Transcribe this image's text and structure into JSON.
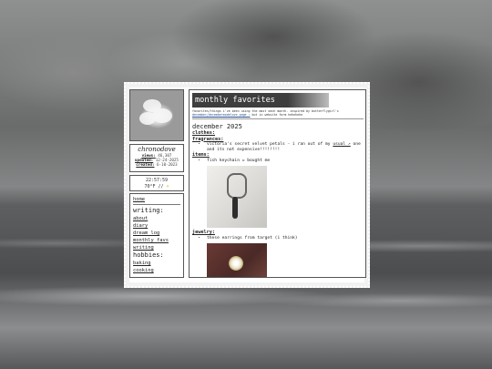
{
  "profile": {
    "name": "chronodove",
    "views_label": "views:",
    "views_value": "46,307",
    "updated_label": "updated:",
    "updated_value": "12-24-2025",
    "created_label": "created:",
    "created_value": "6-10-2023"
  },
  "clock": {
    "time": "22:57:59",
    "weather": "70°F //",
    "weather_icon": "sun-icon"
  },
  "nav": {
    "home": "home",
    "writing_heading": "writing:",
    "writing_items": [
      "about",
      "diary",
      "dream log",
      "monthly favs",
      "writing"
    ],
    "hobbies_heading": "hobbies:",
    "hobbies_items": [
      "baking",
      "cooking"
    ]
  },
  "page": {
    "title": "monthly favorites",
    "subtitle_text": "favorites/things i've been using the most each month. inspired by butterflygirl's",
    "subtitle_link": "december/decembermodelove page ↗",
    "subtitle_tail": "but in website form hehehehe"
  },
  "month": {
    "heading": "december 2025",
    "clothes_label": "clothes:",
    "fragrances_label": "fragrances:",
    "fragrance_item": "victoria's secret velvet petals - i ran out of my",
    "fragrance_link": "usual ↗",
    "fragrance_tail": "one and its not expensive!!!!!!!!",
    "items_label": "items:",
    "items_item": "fish keychain = bought me",
    "jewelry_label": "jewelry:",
    "jewelry_item": "these earrings from target (i think)"
  },
  "colors": {
    "title_bar": "#3e3e3e",
    "link": "#2a4d8f",
    "frame": "#f2f2f2"
  }
}
